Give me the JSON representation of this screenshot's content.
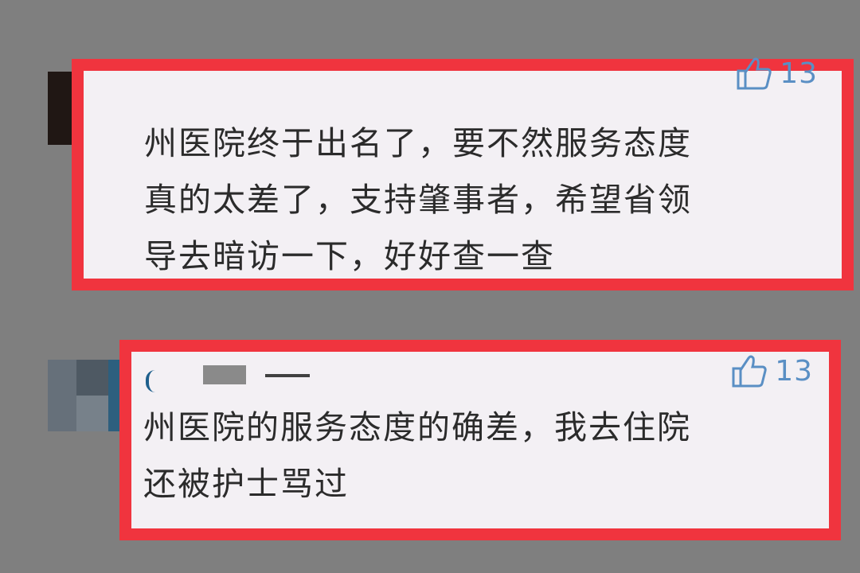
{
  "comments": [
    {
      "text": "州医院终于出名了，要不然服务态度\n真的太差了，支持肇事者，希望省领\n导去暗访一下，好好查一查",
      "likes": "13",
      "like_icon": "thumbs-up-icon"
    },
    {
      "text": "州医院的服务态度的确差，我去住院\n还被护士骂过",
      "likes": "13",
      "like_icon": "thumbs-up-icon"
    }
  ],
  "colors": {
    "background": "#7f7f7f",
    "highlight_border": "#f0343e",
    "comment_background": "#f3f0f4",
    "comment_text": "#2b2b2b",
    "like_icon": "#5a8fc4"
  }
}
